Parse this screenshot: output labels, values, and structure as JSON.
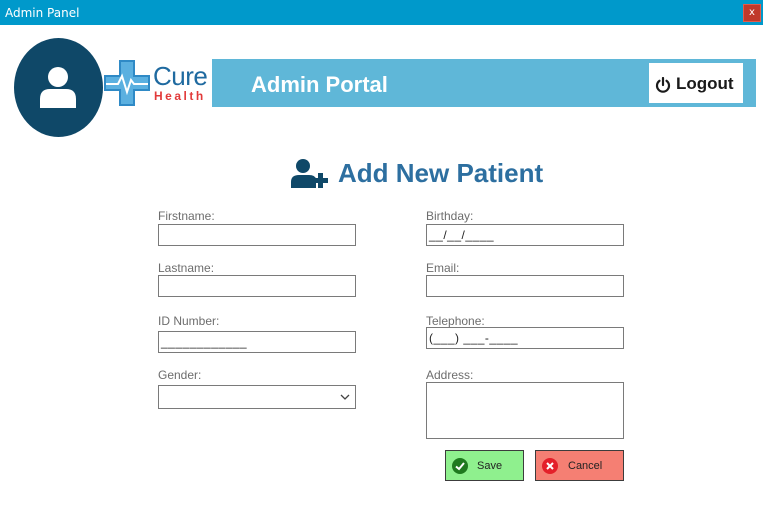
{
  "window": {
    "title": "Admin Panel",
    "close_label": "x"
  },
  "brand": {
    "logo_main": "Cure",
    "logo_sub": "Health"
  },
  "header": {
    "title": "Admin Portal",
    "logout_label": "Logout"
  },
  "form": {
    "title": "Add New Patient",
    "fields": {
      "firstname": {
        "label": "Firstname:",
        "value": ""
      },
      "lastname": {
        "label": "Lastname:",
        "value": ""
      },
      "id_number": {
        "label": "ID Number:",
        "value": "____________"
      },
      "gender": {
        "label": "Gender:",
        "value": ""
      },
      "birthday": {
        "label": "Birthday:",
        "value": "__/__/____"
      },
      "email": {
        "label": "Email:",
        "value": ""
      },
      "telephone": {
        "label": "Telephone:",
        "value": "(___) ___-____"
      },
      "address": {
        "label": "Address:",
        "value": ""
      }
    },
    "save_label": "Save",
    "cancel_label": "Cancel"
  },
  "colors": {
    "titlebar": "#0099cb",
    "header_band": "#5fb7d8",
    "avatar_bg": "#0f4868",
    "heading_text": "#2d6fa0",
    "save_bg": "#8ff08e",
    "cancel_bg": "#f57f73"
  },
  "icons": {
    "avatar": "user-icon",
    "logout": "power-icon",
    "heading": "user-plus-icon",
    "save": "check-circle-icon",
    "cancel": "x-circle-icon",
    "gender_dropdown": "chevron-down-icon"
  }
}
